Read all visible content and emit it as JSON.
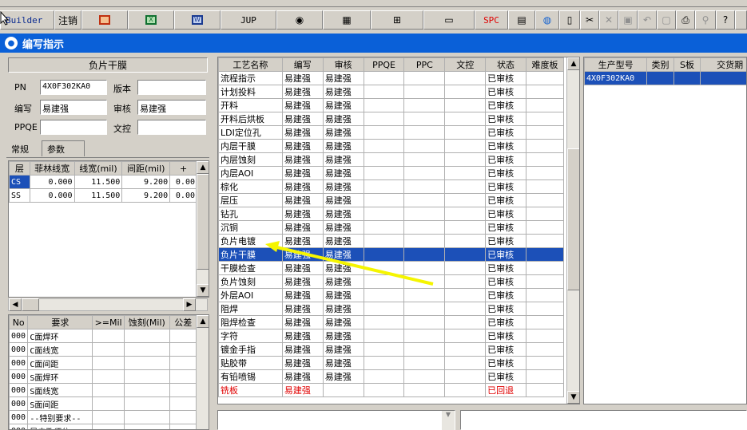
{
  "toolbar": {
    "builder": "Builder",
    "logout": "注销",
    "jup": "JUP",
    "spc": "SPC"
  },
  "window_title": "编写指示",
  "left": {
    "section_title": "负片干膜",
    "pn_label": "PN",
    "pn_value": "4X0F302KA0",
    "version_label": "版本",
    "version_value": "",
    "author_label": "编写",
    "author_value": "易建强",
    "review_label": "审核",
    "review_value": "易建强",
    "ppqe_label": "PPQE",
    "ppqe_value": "",
    "doc_label": "文控",
    "doc_value": "",
    "tabs": [
      "常规",
      "参数"
    ],
    "param_headers": [
      "层",
      "菲林线宽",
      "线宽(mil)",
      "间距(mil)",
      "+"
    ],
    "params": [
      [
        "CS",
        "0.000",
        "11.500",
        "9.200",
        "0.00"
      ],
      [
        "SS",
        "0.000",
        "11.500",
        "9.200",
        "0.00"
      ]
    ],
    "req_headers": [
      "No",
      "要求",
      ">=Mil",
      "蚀刻(Mil)",
      "公差"
    ],
    "reqs": [
      [
        "000",
        "C面焊环"
      ],
      [
        "000",
        "C面线宽"
      ],
      [
        "000",
        "C面间距"
      ],
      [
        "000",
        "S面焊环"
      ],
      [
        "000",
        "S面线宽"
      ],
      [
        "000",
        "S面间距"
      ],
      [
        "000",
        "--特别要求--"
      ],
      [
        "000",
        "导电孔须位"
      ]
    ]
  },
  "process": {
    "headers": [
      "工艺名称",
      "编写",
      "审核",
      "PPQE",
      "PPC",
      "文控",
      "状态",
      "难度板"
    ],
    "rows": [
      [
        "流程指示",
        "易建强",
        "易建强",
        "",
        "",
        "",
        "已审核",
        ""
      ],
      [
        "计划投料",
        "易建强",
        "易建强",
        "",
        "",
        "",
        "已审核",
        ""
      ],
      [
        "开料",
        "易建强",
        "易建强",
        "",
        "",
        "",
        "已审核",
        ""
      ],
      [
        "开料后烘板",
        "易建强",
        "易建强",
        "",
        "",
        "",
        "已审核",
        ""
      ],
      [
        "LDI定位孔",
        "易建强",
        "易建强",
        "",
        "",
        "",
        "已审核",
        ""
      ],
      [
        "内层干膜",
        "易建强",
        "易建强",
        "",
        "",
        "",
        "已审核",
        ""
      ],
      [
        "内层蚀刻",
        "易建强",
        "易建强",
        "",
        "",
        "",
        "已审核",
        ""
      ],
      [
        "内层AOI",
        "易建强",
        "易建强",
        "",
        "",
        "",
        "已审核",
        ""
      ],
      [
        "棕化",
        "易建强",
        "易建强",
        "",
        "",
        "",
        "已审核",
        ""
      ],
      [
        "层压",
        "易建强",
        "易建强",
        "",
        "",
        "",
        "已审核",
        ""
      ],
      [
        "钻孔",
        "易建强",
        "易建强",
        "",
        "",
        "",
        "已审核",
        ""
      ],
      [
        "沉铜",
        "易建强",
        "易建强",
        "",
        "",
        "",
        "已审核",
        ""
      ],
      [
        "负片电镀",
        "易建强",
        "易建强",
        "",
        "",
        "",
        "已审核",
        ""
      ],
      [
        "负片干膜",
        "易建强",
        "易建强",
        "",
        "",
        "",
        "已审核",
        ""
      ],
      [
        "干膜检查",
        "易建强",
        "易建强",
        "",
        "",
        "",
        "已审核",
        ""
      ],
      [
        "负片蚀刻",
        "易建强",
        "易建强",
        "",
        "",
        "",
        "已审核",
        ""
      ],
      [
        "外层AOI",
        "易建强",
        "易建强",
        "",
        "",
        "",
        "已审核",
        ""
      ],
      [
        "阻焊",
        "易建强",
        "易建强",
        "",
        "",
        "",
        "已审核",
        ""
      ],
      [
        "阻焊检查",
        "易建强",
        "易建强",
        "",
        "",
        "",
        "已审核",
        ""
      ],
      [
        "字符",
        "易建强",
        "易建强",
        "",
        "",
        "",
        "已审核",
        ""
      ],
      [
        "镀金手指",
        "易建强",
        "易建强",
        "",
        "",
        "",
        "已审核",
        ""
      ],
      [
        "贴胶带",
        "易建强",
        "易建强",
        "",
        "",
        "",
        "已审核",
        ""
      ],
      [
        "有铅喷锡",
        "易建强",
        "易建强",
        "",
        "",
        "",
        "已审核",
        ""
      ],
      [
        "铣板",
        "易建强",
        "",
        "",
        "",
        "",
        "已回退",
        ""
      ]
    ],
    "selected_index": 13,
    "rejected_index": 23
  },
  "right": {
    "headers": [
      "生产型号",
      "类别",
      "S板",
      "交货期"
    ],
    "rows": [
      [
        "4X0F302KA0",
        "",
        "",
        ""
      ]
    ]
  },
  "colors": {
    "title_bar": "#0a60d8",
    "selection": "#1c50b8",
    "annotation_arrow": "#f5f500",
    "rejected": "#e00000"
  }
}
